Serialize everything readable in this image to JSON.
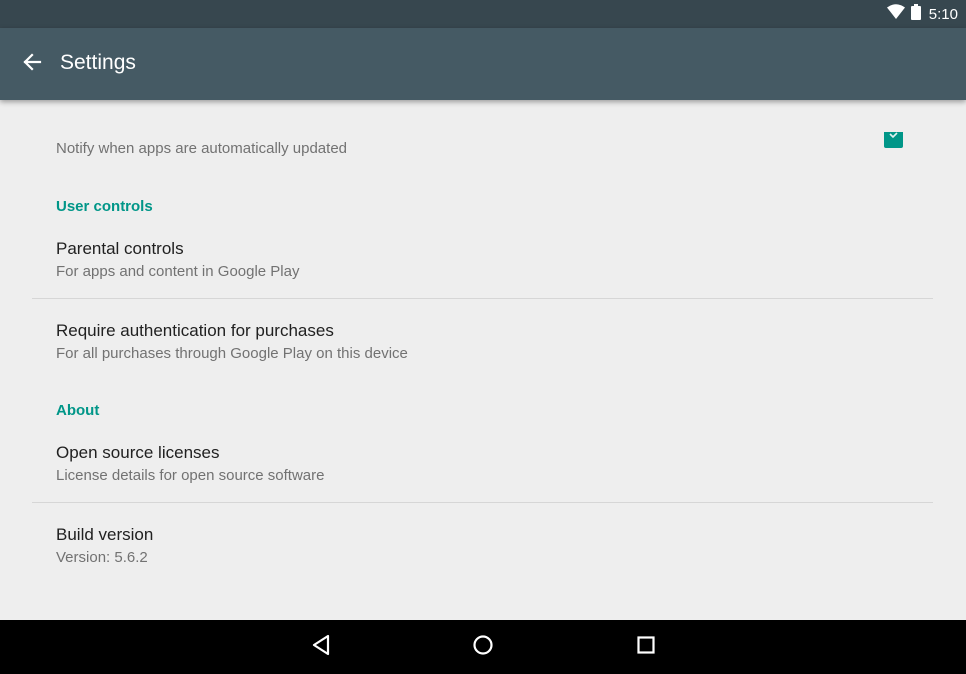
{
  "status_bar": {
    "time": "5:10",
    "icons": [
      "wifi-icon",
      "battery-icon"
    ]
  },
  "app_bar": {
    "title": "Settings",
    "back_icon": "arrow-back-icon"
  },
  "colors": {
    "status_bar": "#37474f",
    "app_bar": "#455a64",
    "accent": "#009688",
    "background": "#eeeeee"
  },
  "general": {
    "notify_summary": "Notify when apps are automatically updated",
    "notify_checked": true
  },
  "user_controls": {
    "header": "User controls",
    "items": [
      {
        "title": "Parental controls",
        "summary": "For apps and content in Google Play"
      },
      {
        "title": "Require authentication for purchases",
        "summary": "For all purchases through Google Play on this device"
      }
    ]
  },
  "about": {
    "header": "About",
    "items": [
      {
        "title": "Open source licenses",
        "summary": "License details for open source software"
      },
      {
        "title": "Build version",
        "summary": "Version: 5.6.2"
      }
    ]
  },
  "nav_bar": {
    "buttons": [
      "back-triangle-icon",
      "home-circle-icon",
      "recents-square-icon"
    ]
  }
}
